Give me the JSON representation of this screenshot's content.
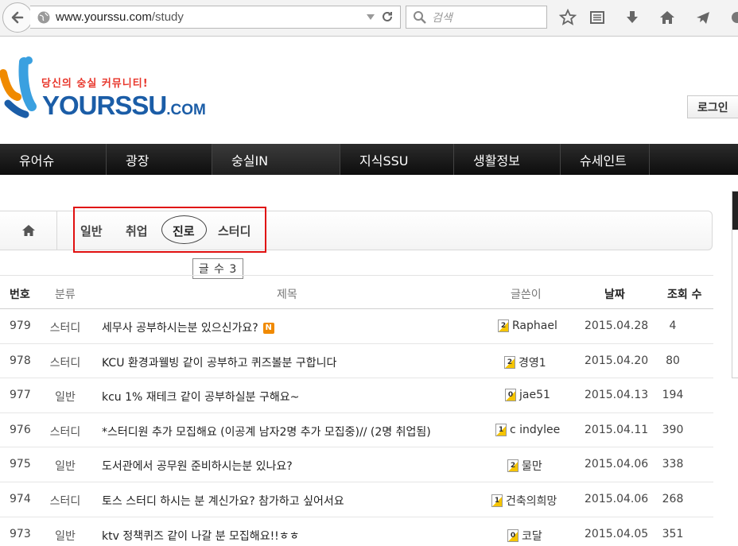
{
  "browser": {
    "url_host": "www.yourssu.com",
    "url_path": "/study",
    "search_placeholder": "검색"
  },
  "site": {
    "slogan": "당신의 숭실 커뮤니티!",
    "brand": "YOURSSU",
    "brand_suffix": ".COM",
    "login_label": "로그인"
  },
  "nav": {
    "items": [
      {
        "label": "유어슈"
      },
      {
        "label": "광장"
      },
      {
        "label": "숭실IN"
      },
      {
        "label": "지식SSU"
      },
      {
        "label": "생활정보"
      },
      {
        "label": "슈세인트"
      }
    ]
  },
  "categories": {
    "items": [
      {
        "label": "일반"
      },
      {
        "label": "취업"
      },
      {
        "label": "진로"
      },
      {
        "label": "스터디"
      }
    ],
    "active": "진로",
    "post_count": "글 수 3"
  },
  "table": {
    "headers": {
      "no": "번호",
      "category": "분류",
      "title": "제목",
      "author": "글쓴이",
      "date": "날짜",
      "views": "조회 수"
    },
    "new_badge": "N",
    "rows": [
      {
        "no": "979",
        "category": "스터디",
        "title": "세무사 공부하시는분 있으신가요?",
        "is_new": true,
        "level": "2",
        "author": "Raphael",
        "date": "2015.04.28",
        "views": "4"
      },
      {
        "no": "978",
        "category": "스터디",
        "title": "KCU 환경과웰빙 같이 공부하고 퀴즈볼분 구합니다",
        "is_new": false,
        "level": "2",
        "author": "경영1",
        "date": "2015.04.20",
        "views": "80"
      },
      {
        "no": "977",
        "category": "일반",
        "title": "kcu 1% 재테크 같이 공부하실분 구해요~",
        "is_new": false,
        "level": "0",
        "author": "jae51",
        "date": "2015.04.13",
        "views": "194"
      },
      {
        "no": "976",
        "category": "스터디",
        "title": "*스터디원 추가 모집해요 (이공계 남자2명 추가 모집중)// (2명 취업됨)",
        "is_new": false,
        "level": "1",
        "author": "c indylee",
        "date": "2015.04.11",
        "views": "390"
      },
      {
        "no": "975",
        "category": "일반",
        "title": "도서관에서 공무원 준비하시는분 있나요?",
        "is_new": false,
        "level": "2",
        "author": "물만",
        "date": "2015.04.06",
        "views": "338"
      },
      {
        "no": "974",
        "category": "스터디",
        "title": "토스 스터디 하시는 분 계신가요? 참가하고 싶어서요",
        "is_new": false,
        "level": "1",
        "author": "건축의희망",
        "date": "2015.04.06",
        "views": "268"
      },
      {
        "no": "973",
        "category": "일반",
        "title": "ktv 정책퀴즈 같이 나갈 분 모집해요!!ㅎㅎ",
        "is_new": false,
        "level": "0",
        "author": "코달",
        "date": "2015.04.05",
        "views": "351"
      }
    ]
  }
}
